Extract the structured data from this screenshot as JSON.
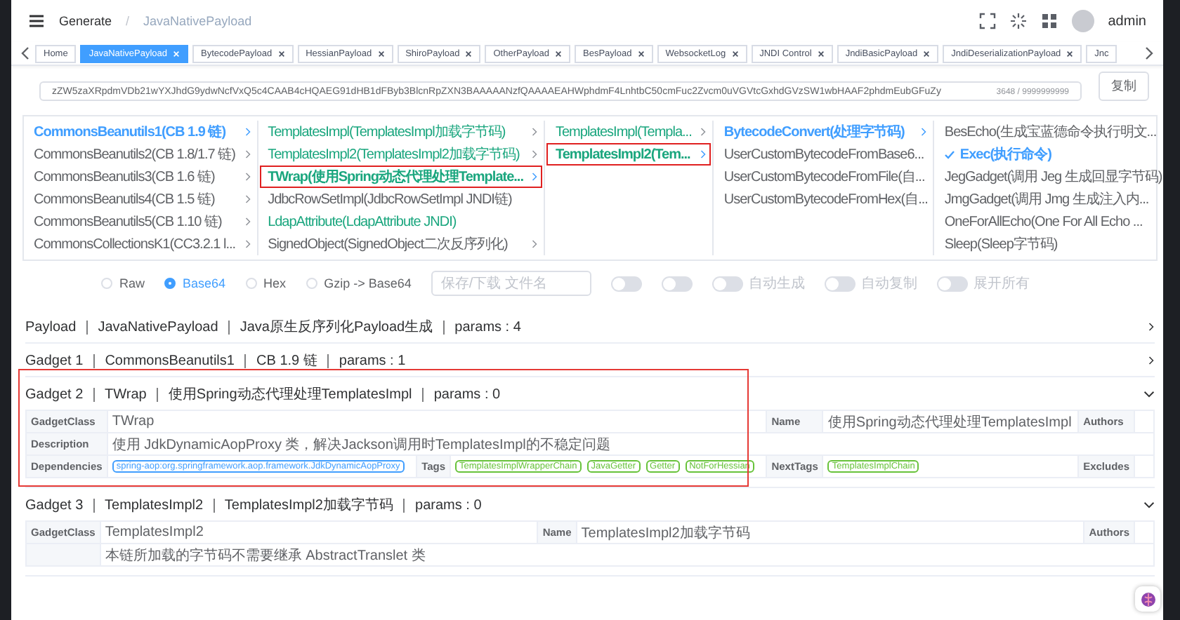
{
  "header": {
    "breadcrumb": [
      "Generate",
      "JavaNativePayload"
    ],
    "separator": "/",
    "user": "admin"
  },
  "tabs": [
    {
      "label": "Home",
      "selected": false,
      "closable": false
    },
    {
      "label": "JavaNativePayload",
      "selected": true,
      "closable": true
    },
    {
      "label": "BytecodePayload",
      "selected": false,
      "closable": true
    },
    {
      "label": "HessianPayload",
      "selected": false,
      "closable": true
    },
    {
      "label": "ShiroPayload",
      "selected": false,
      "closable": true
    },
    {
      "label": "OtherPayload",
      "selected": false,
      "closable": true
    },
    {
      "label": "BesPayload",
      "selected": false,
      "closable": true
    },
    {
      "label": "WebsocketLog",
      "selected": false,
      "closable": true
    },
    {
      "label": "JNDI Control",
      "selected": false,
      "closable": true
    },
    {
      "label": "JndiBasicPayload",
      "selected": false,
      "closable": true
    },
    {
      "label": "JndiDeserializationPayload",
      "selected": false,
      "closable": true
    },
    {
      "label": "Jnc",
      "selected": false,
      "closable": false
    }
  ],
  "output": {
    "value": "zZW5zaXRpdmVDb21wYXJhdG9ydwNcfVxQ5c4CAAB4cHQAEG91dHB1dFByb3BlcnRpZXN3BAAAAANzfQAAAAEAHWphdmF4LnhtbC50cmFuc2Zvcm0uVGVtcGxhdGVzSW1wbHAAF2phdmEubGFuZy",
    "counter": "3648 / 9999999999",
    "copy_button": "复制"
  },
  "cascader": [
    [
      {
        "label": "CommonsBeanutils1(CB 1.9 链)",
        "color": "#409eff",
        "selected": true,
        "expandable": true,
        "highlighted": false
      },
      {
        "label": "CommonsBeanutils2(CB 1.8/1.7 链)",
        "color": "#606266",
        "selected": false,
        "expandable": true,
        "highlighted": false
      },
      {
        "label": "CommonsBeanutils3(CB 1.6 链)",
        "color": "#606266",
        "selected": false,
        "expandable": true,
        "highlighted": false
      },
      {
        "label": "CommonsBeanutils4(CB 1.5 链)",
        "color": "#606266",
        "selected": false,
        "expandable": true,
        "highlighted": false
      },
      {
        "label": "CommonsBeanutils5(CB 1.10 链)",
        "color": "#606266",
        "selected": false,
        "expandable": true,
        "highlighted": false
      },
      {
        "label": "CommonsCollectionsK1(CC3.2.1 l...",
        "color": "#606266",
        "selected": false,
        "expandable": true,
        "highlighted": false
      }
    ],
    [
      {
        "label": "TemplatesImpl(TemplatesImpl加载字节码)",
        "color": "#1aa67e",
        "selected": false,
        "expandable": true,
        "highlighted": false
      },
      {
        "label": "TemplatesImpl2(TemplatesImpl2加载字节码)",
        "color": "#1aa67e",
        "selected": false,
        "expandable": true,
        "highlighted": false
      },
      {
        "label": "TWrap(使用Spring动态代理处理Template...",
        "color": "#1aa67e",
        "selected": true,
        "expandable": true,
        "highlighted": true
      },
      {
        "label": "JdbcRowSetImpl(JdbcRowSetImpl JNDI链)",
        "color": "#606266",
        "selected": false,
        "expandable": false,
        "highlighted": false
      },
      {
        "label": "LdapAttribute(LdapAttribute JNDI)",
        "color": "#1aa67e",
        "selected": false,
        "expandable": false,
        "highlighted": false
      },
      {
        "label": "SignedObject(SignedObject二次反序列化)",
        "color": "#606266",
        "selected": false,
        "expandable": true,
        "highlighted": false
      }
    ],
    [
      {
        "label": "TemplatesImpl(Templa...",
        "color": "#1aa67e",
        "selected": false,
        "expandable": true,
        "highlighted": false
      },
      {
        "label": "TemplatesImpl2(Tem...",
        "color": "#1aa67e",
        "selected": true,
        "expandable": true,
        "highlighted": true
      }
    ],
    [
      {
        "label": "BytecodeConvert(处理字节码)",
        "color": "#409eff",
        "selected": true,
        "expandable": true,
        "highlighted": false
      },
      {
        "label": "UserCustomBytecodeFromBase6...",
        "color": "#606266",
        "selected": false,
        "expandable": false,
        "highlighted": false
      },
      {
        "label": "UserCustomBytecodeFromFile(自...",
        "color": "#606266",
        "selected": false,
        "expandable": false,
        "highlighted": false
      },
      {
        "label": "UserCustomBytecodeFromHex(自...",
        "color": "#606266",
        "selected": false,
        "expandable": false,
        "highlighted": false
      }
    ],
    [
      {
        "label": "BesEcho(生成宝蓝德命令执行明文...",
        "color": "#606266",
        "selected": false,
        "expandable": false,
        "highlighted": false,
        "checked": false
      },
      {
        "label": "Exec(执行命令)",
        "color": "#409eff",
        "selected": true,
        "expandable": false,
        "highlighted": false,
        "checked": true
      },
      {
        "label": "JegGadget(调用 Jeg 生成回显字节码)",
        "color": "#606266",
        "selected": false,
        "expandable": false,
        "highlighted": false,
        "checked": false
      },
      {
        "label": "JmgGadget(调用 Jmg 生成注入内...",
        "color": "#606266",
        "selected": false,
        "expandable": false,
        "highlighted": false,
        "checked": false
      },
      {
        "label": "OneForAllEcho(One For All Echo ...",
        "color": "#606266",
        "selected": false,
        "expandable": false,
        "highlighted": false,
        "checked": false
      },
      {
        "label": "Sleep(Sleep字节码)",
        "color": "#606266",
        "selected": false,
        "expandable": false,
        "highlighted": false,
        "checked": false
      }
    ]
  ],
  "encoding": [
    {
      "label": "Raw",
      "selected": false
    },
    {
      "label": "Base64",
      "selected": true
    },
    {
      "label": "Hex",
      "selected": false
    },
    {
      "label": "Gzip -> Base64",
      "selected": false
    }
  ],
  "filename": {
    "placeholder": "保存/下载 文件名"
  },
  "switches": [
    {
      "on": false
    },
    {
      "on": false
    },
    {
      "label": "自动生成",
      "on": false
    },
    {
      "label": "自动复制",
      "on": false
    },
    {
      "label": "展开所有",
      "on": false
    }
  ],
  "sections": [
    {
      "title": "Payload ｜ JavaNativePayload ｜ Java原生反序列化Payload生成 ｜ params : 4",
      "expanded": false,
      "annotated": false
    },
    {
      "title": "Gadget 1 ｜ CommonsBeanutils1 ｜ CB 1.9 链 ｜ params : 1",
      "expanded": false,
      "annotated": false
    },
    {
      "title": "Gadget 2 ｜ TWrap ｜ 使用Spring动态代理处理TemplatesImpl ｜ params : 0",
      "expanded": true,
      "annotated": true,
      "rows": [
        [
          {
            "kind": "label",
            "text": "GadgetClass"
          },
          {
            "kind": "text",
            "text": "TWrap"
          },
          {
            "kind": "merged"
          },
          {
            "kind": "merged"
          },
          {
            "kind": "label",
            "text": "Name"
          },
          {
            "kind": "text",
            "text": "使用Spring动态代理处理TemplatesImpl"
          },
          {
            "kind": "label",
            "text": "Authors"
          },
          {
            "kind": "empty"
          }
        ],
        [
          {
            "kind": "label",
            "text": "Description"
          },
          {
            "kind": "text",
            "text": "使用 JdkDynamicAopProxy 类，解决Jackson调用时TemplatesImpl的不稳定问题"
          },
          {
            "kind": "merged"
          },
          {
            "kind": "merged"
          },
          {
            "kind": "merged"
          },
          {
            "kind": "merged"
          },
          {
            "kind": "merged"
          },
          {
            "kind": "merged"
          }
        ],
        [
          {
            "kind": "label",
            "text": "Dependencies"
          },
          {
            "kind": "tags",
            "color": "#409eff",
            "tags": [
              "spring-aop:org.springframework.aop.framework.JdkDynamicAopProxy"
            ]
          },
          {
            "kind": "label",
            "text": "Tags"
          },
          {
            "kind": "tags",
            "color": "#67c23a",
            "tags": [
              "TemplatesImplWrapperChain",
              "JavaGetter",
              "Getter",
              "NotForHessian"
            ]
          },
          {
            "kind": "label",
            "text": "NextTags"
          },
          {
            "kind": "tags",
            "color": "#67c23a",
            "tags": [
              "TemplatesImplChain"
            ]
          },
          {
            "kind": "label",
            "text": "Excludes"
          },
          {
            "kind": "empty"
          }
        ]
      ]
    },
    {
      "title": "Gadget 3 ｜ TemplatesImpl2 ｜ TemplatesImpl2加载字节码 ｜ params : 0",
      "expanded": true,
      "annotated": false,
      "rows": [
        [
          {
            "kind": "label",
            "text": "GadgetClass"
          },
          {
            "kind": "text",
            "text": "TemplatesImpl2"
          },
          {
            "kind": "label",
            "text": "Name"
          },
          {
            "kind": "text",
            "text": "TemplatesImpl2加载字节码"
          },
          {
            "kind": "label",
            "text": "Authors"
          },
          {
            "kind": "empty"
          }
        ],
        [
          {
            "kind": "label"
          },
          {
            "kind": "text",
            "text": "本链所加载的字节码不需要继承 AbstractTranslet 类"
          },
          {
            "kind": "merged"
          },
          {
            "kind": "merged"
          },
          {
            "kind": "merged"
          },
          {
            "kind": "merged"
          }
        ]
      ]
    }
  ]
}
